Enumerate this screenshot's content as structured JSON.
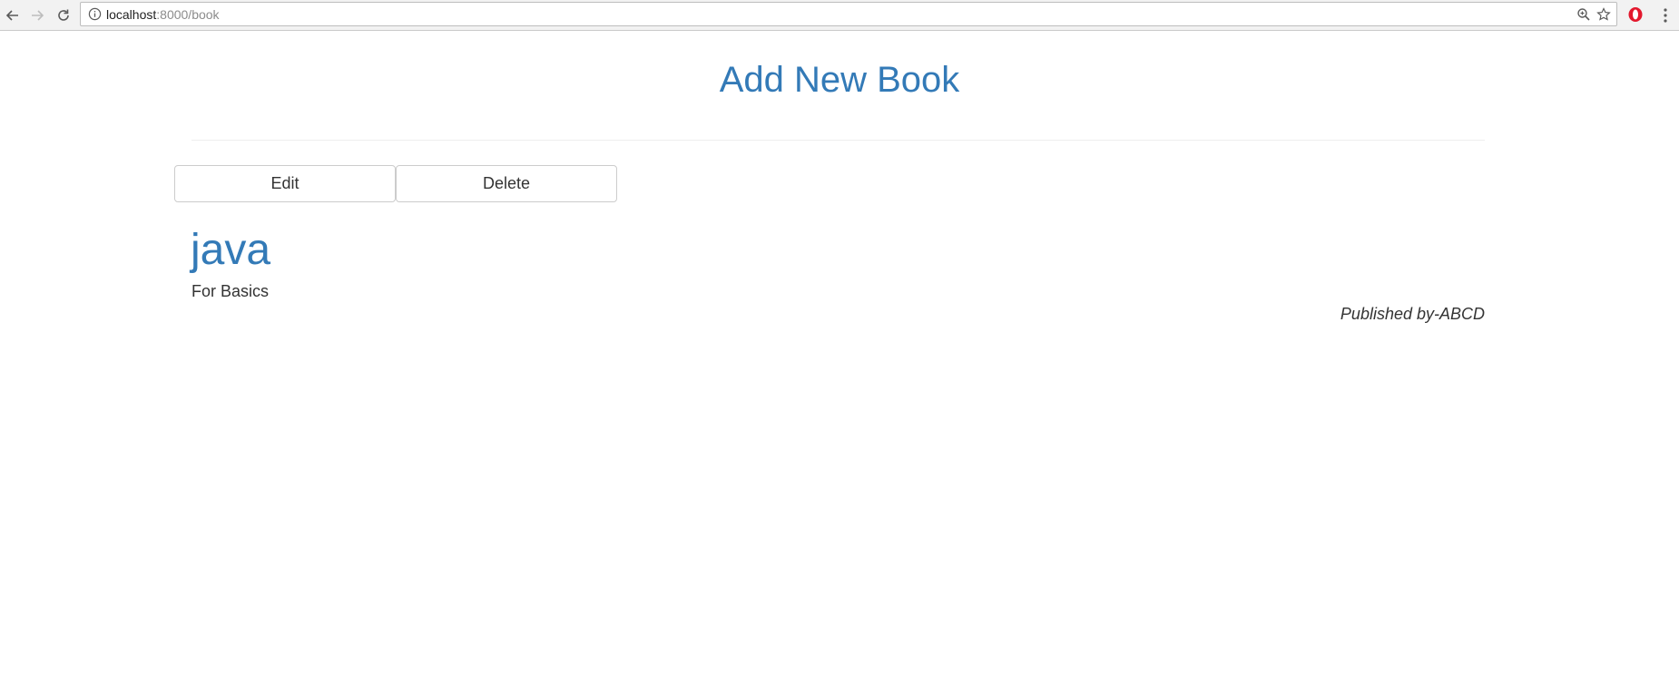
{
  "browser": {
    "url_host": "localhost",
    "url_rest": ":8000/book",
    "icons": {
      "back": "back-arrow-icon",
      "forward": "forward-arrow-icon",
      "reload": "reload-icon",
      "info": "info-icon",
      "zoom": "zoom-icon",
      "bookmark": "bookmark-star-icon",
      "extension": "opera-extension-icon",
      "menu": "kebab-menu-icon"
    }
  },
  "page": {
    "title": "Add New Book",
    "actions": {
      "edit_label": "Edit",
      "delete_label": "Delete"
    },
    "book": {
      "title": "java",
      "description": "For Basics",
      "publisher": "Published by-ABCD"
    }
  },
  "colors": {
    "link": "#337ab7",
    "text": "#333333",
    "divider": "#eeeeee",
    "button_border": "#cccccc"
  }
}
